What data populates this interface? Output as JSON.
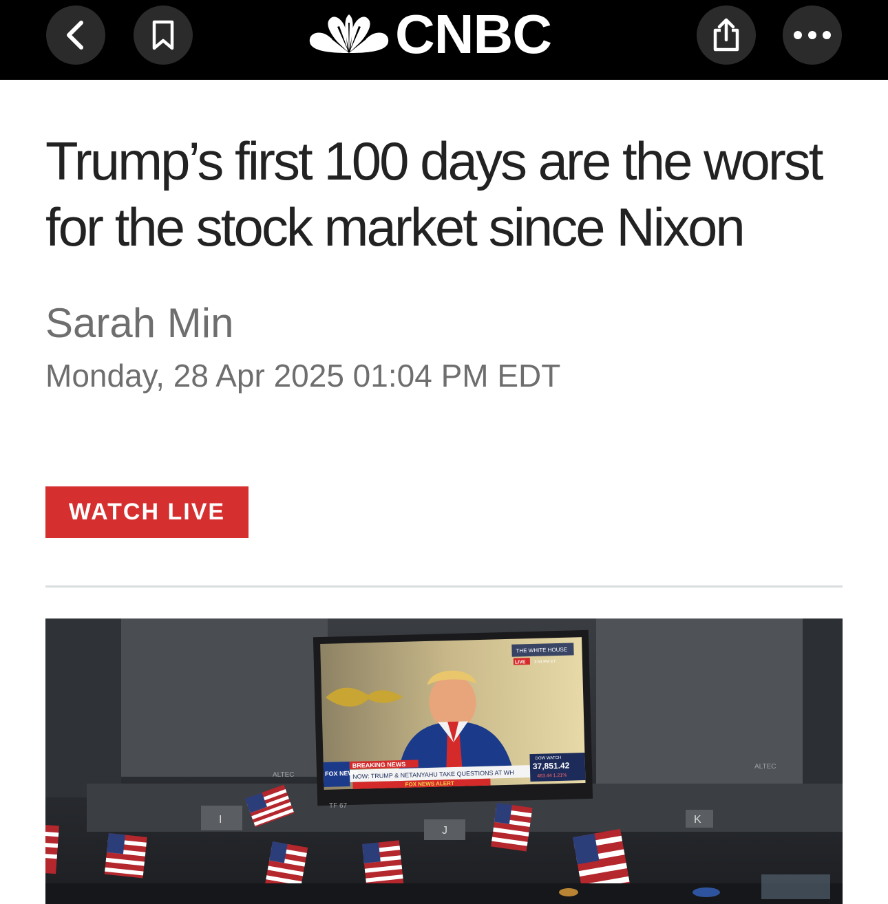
{
  "topbar": {
    "brand": "CNBC",
    "back_icon": "chevron-left-icon",
    "bookmark_icon": "bookmark-icon",
    "share_icon": "share-icon",
    "more_icon": "ellipsis-icon"
  },
  "article": {
    "headline": "Trump’s first 100 days are the worst for the stock market since Nixon",
    "author": "Sarah Min",
    "date": "Monday, 28 Apr 2025 01:04 PM EDT",
    "watch_live": "WATCH LIVE"
  },
  "hero": {
    "tv_top_label": "THE WHITE HOUSE",
    "tv_live": "LIVE",
    "tv_time": "3:53 PM ET",
    "breaking": "BREAKING NEWS",
    "ticker": "NOW: TRUMP & NETANYAHU TAKE QUESTIONS AT WH",
    "alert": "FOX NEWS ALERT",
    "fox_logo": "FOX NEWS",
    "dow_label": "DOW WATCH",
    "dow_value": "37,851.42",
    "dow_change": "463.44 1.21%",
    "post_tf": "TF 67",
    "post_i": "I",
    "post_j": "J",
    "post_k": "K",
    "altec_left": "ALTEC",
    "altec_right": "ALTEC"
  },
  "colors": {
    "topbar_bg": "#000000",
    "button_bg": "#2b2b2b",
    "watch_live_bg": "#d62f2f",
    "headline": "#222222",
    "meta": "#6e6e6e"
  }
}
